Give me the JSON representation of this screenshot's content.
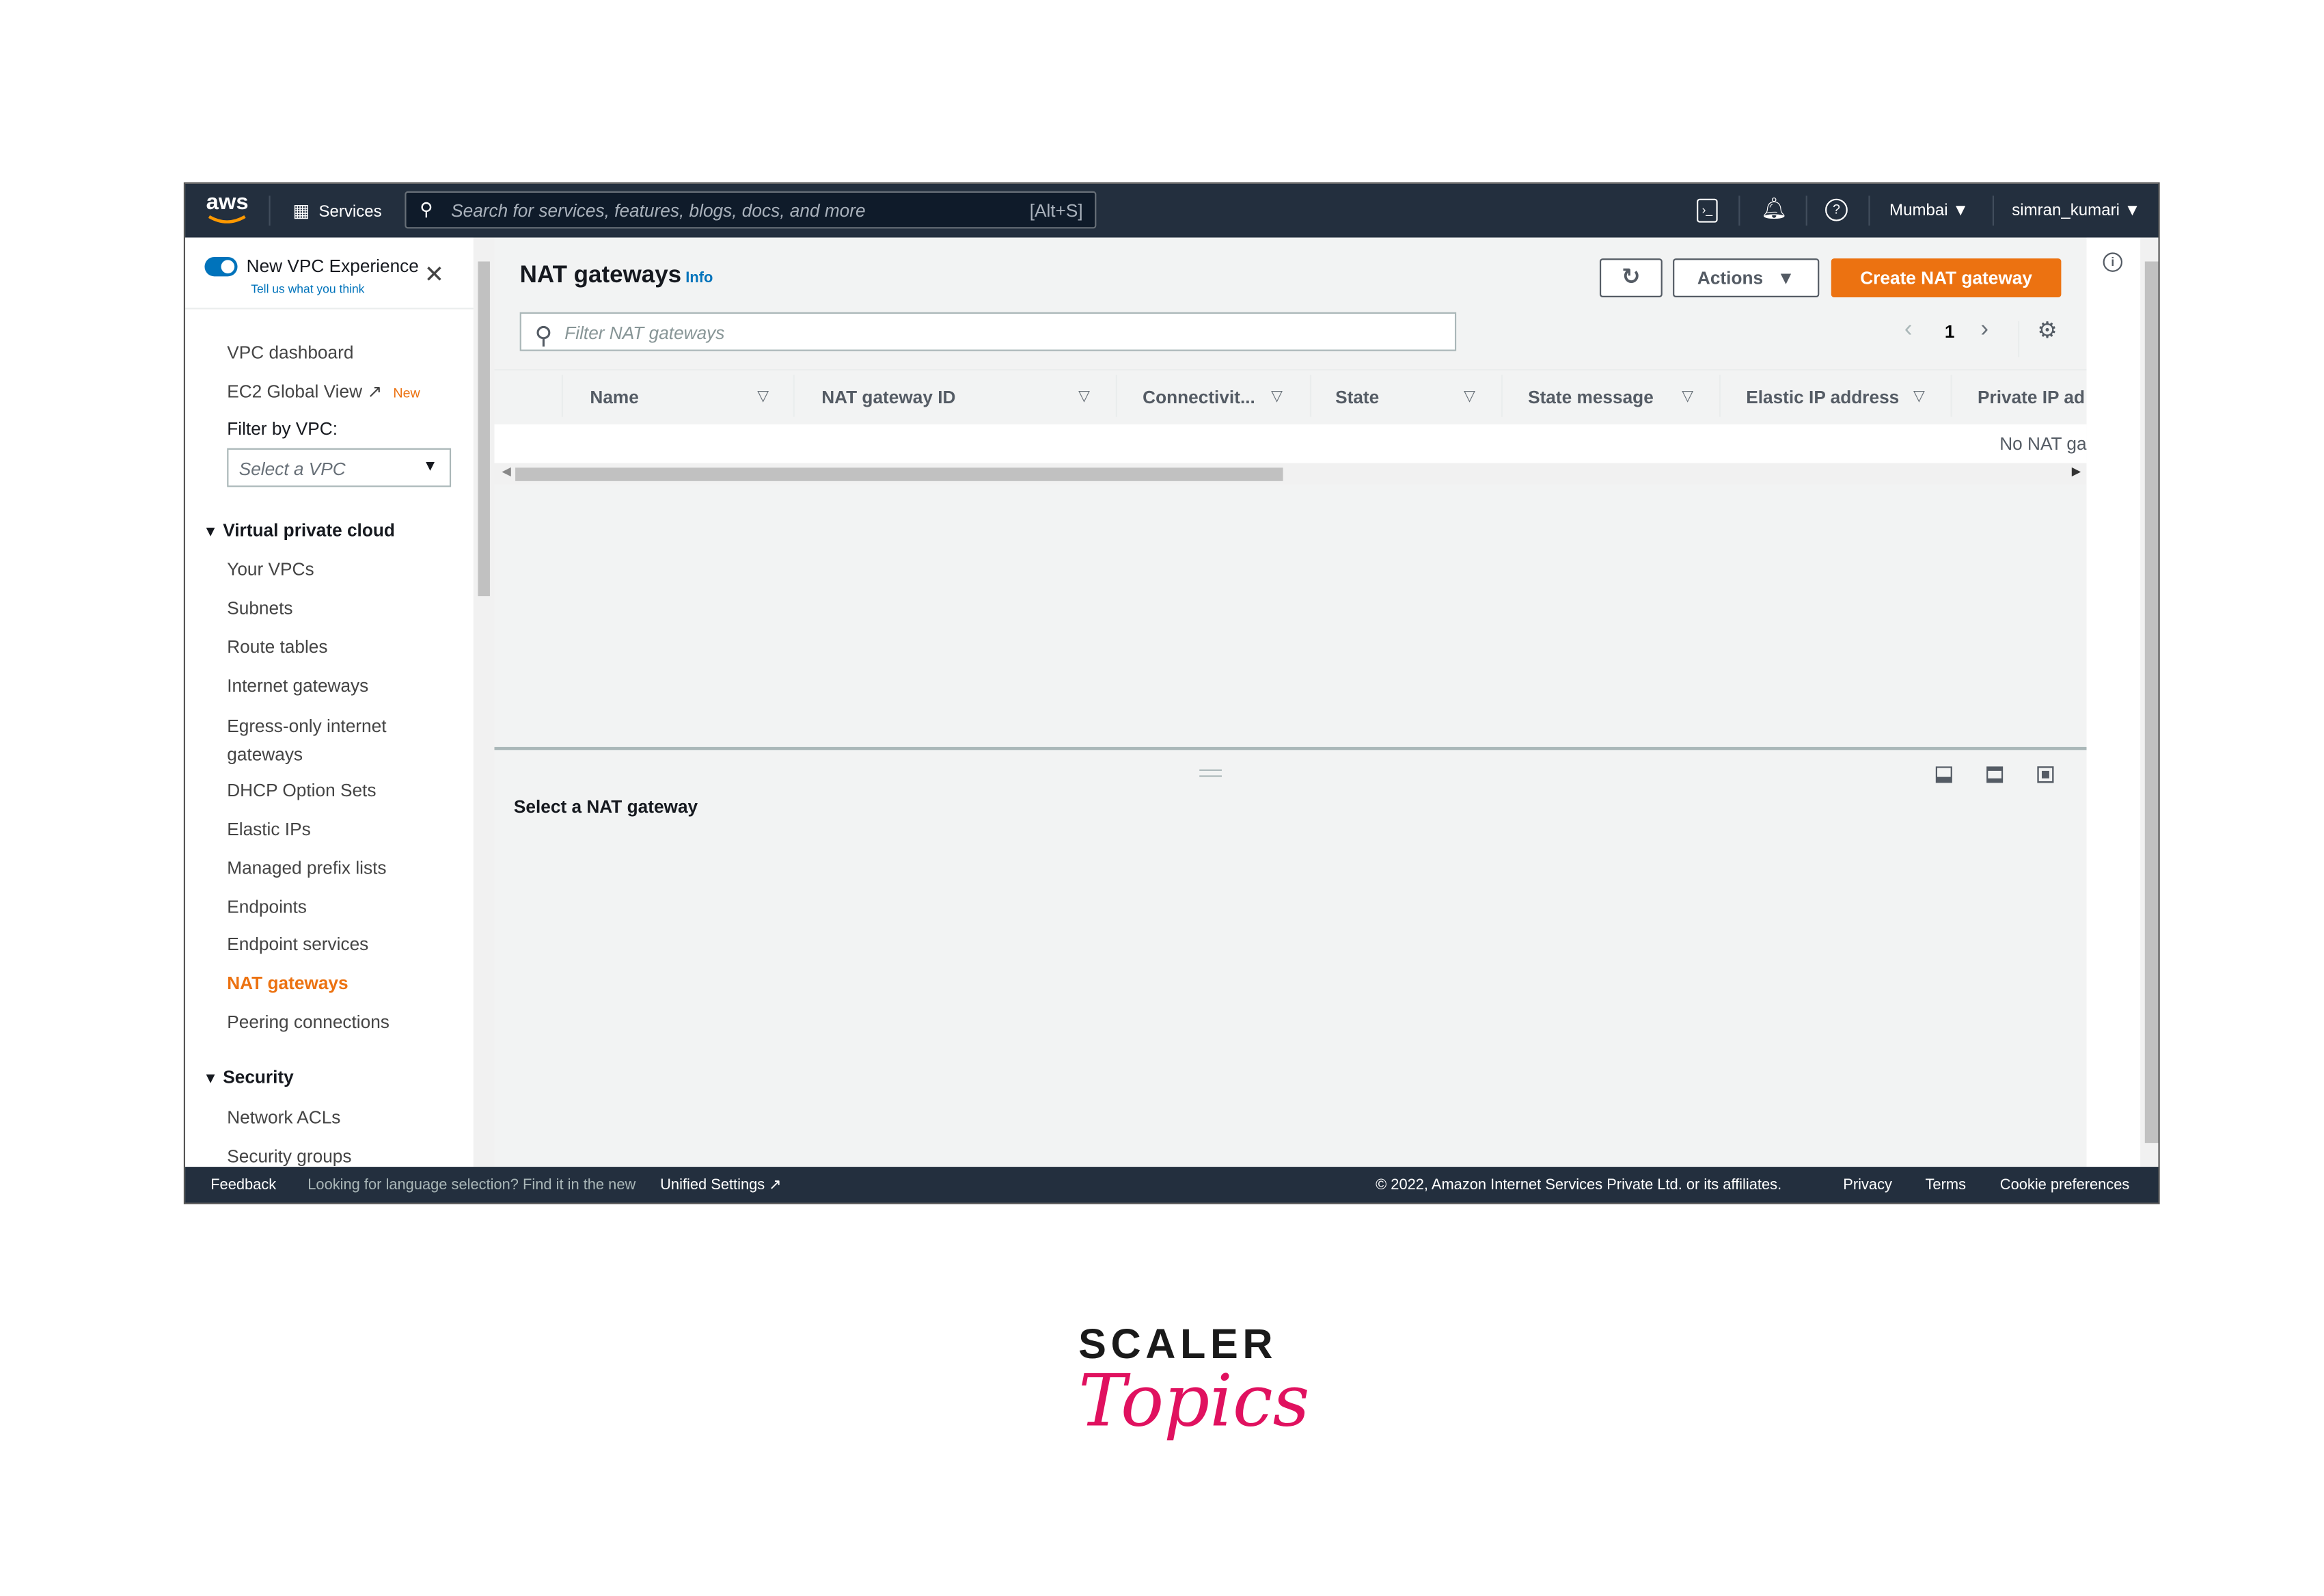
{
  "topbar": {
    "logo": "aws",
    "services": "Services",
    "search_placeholder": "Search for services, features, blogs, docs, and more",
    "search_shortcut": "[Alt+S]",
    "region": "Mumbai",
    "user": "simran_kumari"
  },
  "sidebar": {
    "toggle_label": "New VPC Experience",
    "feedback_link": "Tell us what you think",
    "top_items": [
      "VPC dashboard",
      "EC2 Global View"
    ],
    "new_badge": "New",
    "filter_label": "Filter by VPC:",
    "filter_placeholder": "Select a VPC",
    "section_vpc": "Virtual private cloud",
    "vpc_items": [
      "Your VPCs",
      "Subnets",
      "Route tables",
      "Internet gateways",
      "Egress-only internet gateways",
      "DHCP Option Sets",
      "Elastic IPs",
      "Managed prefix lists",
      "Endpoints",
      "Endpoint services",
      "NAT gateways",
      "Peering connections"
    ],
    "active_item": "NAT gateways",
    "section_security": "Security",
    "security_items": [
      "Network ACLs",
      "Security groups"
    ]
  },
  "main": {
    "title": "NAT gateways",
    "info": "Info",
    "actions": "Actions",
    "create": "Create NAT gateway",
    "filter_placeholder": "Filter NAT gateways",
    "page": "1",
    "columns": [
      "Name",
      "NAT gateway ID",
      "Connectivit...",
      "State",
      "State message",
      "Elastic IP address",
      "Private IP ad"
    ],
    "empty": "No NAT ga",
    "detail_title": "Select a NAT gateway"
  },
  "footer": {
    "feedback": "Feedback",
    "lang_text": "Looking for language selection? Find it in the new",
    "unified": "Unified Settings",
    "copyright": "© 2022, Amazon Internet Services Private Ltd. or its affiliates.",
    "privacy": "Privacy",
    "terms": "Terms",
    "cookies": "Cookie preferences"
  },
  "brand": {
    "line1": "SCALER",
    "line2": "Topics"
  },
  "colors": {
    "accent": "#ec7211",
    "link": "#0073bb",
    "nav_bg": "#232f3e",
    "brand_pink": "#e0115f"
  }
}
